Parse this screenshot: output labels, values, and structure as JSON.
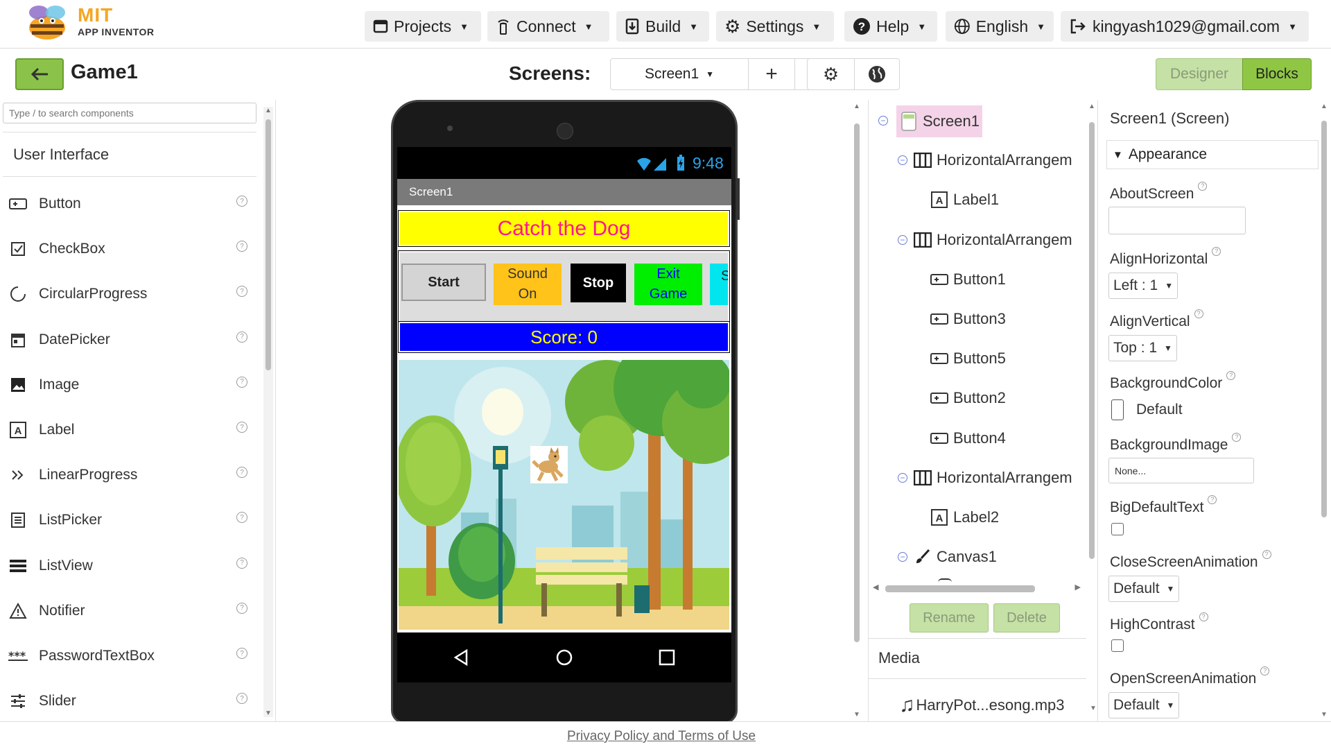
{
  "brand": {
    "line1": "MIT",
    "line2": "APP INVENTOR"
  },
  "topnav": {
    "projects": "Projects",
    "connect": "Connect",
    "build": "Build",
    "settings": "Settings",
    "help": "Help",
    "language": "English",
    "account": "kingyash1029@gmail.com"
  },
  "project": {
    "name": "Game1"
  },
  "screens": {
    "label": "Screens:",
    "selected": "Screen1",
    "add": "+",
    "remove": "—"
  },
  "modes": {
    "designer": "Designer",
    "blocks": "Blocks"
  },
  "palette": {
    "search_placeholder": "Type / to search components",
    "category": "User Interface",
    "items": [
      {
        "label": "Button",
        "icon": "button-icon"
      },
      {
        "label": "CheckBox",
        "icon": "checkbox-icon"
      },
      {
        "label": "CircularProgress",
        "icon": "circular-progress-icon"
      },
      {
        "label": "DatePicker",
        "icon": "calendar-icon"
      },
      {
        "label": "Image",
        "icon": "image-icon"
      },
      {
        "label": "Label",
        "icon": "label-icon"
      },
      {
        "label": "LinearProgress",
        "icon": "linear-progress-icon"
      },
      {
        "label": "ListPicker",
        "icon": "list-picker-icon"
      },
      {
        "label": "ListView",
        "icon": "list-view-icon"
      },
      {
        "label": "Notifier",
        "icon": "warning-icon"
      },
      {
        "label": "PasswordTextBox",
        "icon": "password-icon"
      },
      {
        "label": "Slider",
        "icon": "slider-icon"
      }
    ],
    "help_glyph": "?"
  },
  "phone": {
    "time": "9:48",
    "title_bar": "Screen1",
    "title_label": "Catch the Dog",
    "buttons": [
      {
        "text": "Start"
      },
      {
        "line1": "Sound",
        "line2": "On"
      },
      {
        "text": "Stop"
      },
      {
        "line1": "Exit",
        "line2": "Game"
      },
      {
        "text": "S"
      }
    ],
    "score_label": "Score: 0",
    "colors": {
      "title_bg": "#ffff00",
      "title_fg": "#ff1493",
      "score_bg": "#0000ff",
      "score_fg": "#ffff00",
      "sound_bg": "#ffc31a",
      "exit_bg": "#00ee00",
      "exit_fg": "#0000ff",
      "fifth_bg": "#00e5ee"
    }
  },
  "components_tree": {
    "items": [
      {
        "label": "Screen1",
        "icon": "screen-icon",
        "level": 0,
        "toggle": "−",
        "selected": true
      },
      {
        "label": "HorizontalArrangem",
        "icon": "horizontal-arrangement-icon",
        "level": 1,
        "toggle": "−"
      },
      {
        "label": "Label1",
        "icon": "label-icon",
        "level": 2
      },
      {
        "label": "HorizontalArrangem",
        "icon": "horizontal-arrangement-icon",
        "level": 1,
        "toggle": "−"
      },
      {
        "label": "Button1",
        "icon": "button-icon",
        "level": 2
      },
      {
        "label": "Button3",
        "icon": "button-icon",
        "level": 2
      },
      {
        "label": "Button5",
        "icon": "button-icon",
        "level": 2
      },
      {
        "label": "Button2",
        "icon": "button-icon",
        "level": 2
      },
      {
        "label": "Button4",
        "icon": "button-icon",
        "level": 2
      },
      {
        "label": "HorizontalArrangem",
        "icon": "horizontal-arrangement-icon",
        "level": 1,
        "toggle": "−"
      },
      {
        "label": "Label2",
        "icon": "label-icon",
        "level": 2
      },
      {
        "label": "Canvas1",
        "icon": "brush-icon",
        "level": 1,
        "toggle": "−"
      }
    ],
    "rename": "Rename",
    "delete": "Delete"
  },
  "media": {
    "heading": "Media",
    "file": "HarryPot...esong.mp3"
  },
  "properties": {
    "header": "Screen1 (Screen)",
    "section": "Appearance",
    "about_screen": "AboutScreen",
    "align_horizontal": "AlignHorizontal",
    "align_horizontal_value": "Left : 1",
    "align_vertical": "AlignVertical",
    "align_vertical_value": "Top : 1",
    "background_color": "BackgroundColor",
    "background_color_value": "Default",
    "background_image": "BackgroundImage",
    "background_image_value": "None...",
    "big_default_text": "BigDefaultText",
    "close_screen_animation": "CloseScreenAnimation",
    "close_screen_animation_value": "Default",
    "high_contrast": "HighContrast",
    "open_screen_animation": "OpenScreenAnimation",
    "open_screen_animation_value": "Default"
  },
  "footer": {
    "link": "Privacy Policy and Terms of Use"
  },
  "theme": {
    "accent_green": "#8bc34a",
    "blocks_bg": "#8fc744",
    "selected_row": "#f4d3e8"
  }
}
